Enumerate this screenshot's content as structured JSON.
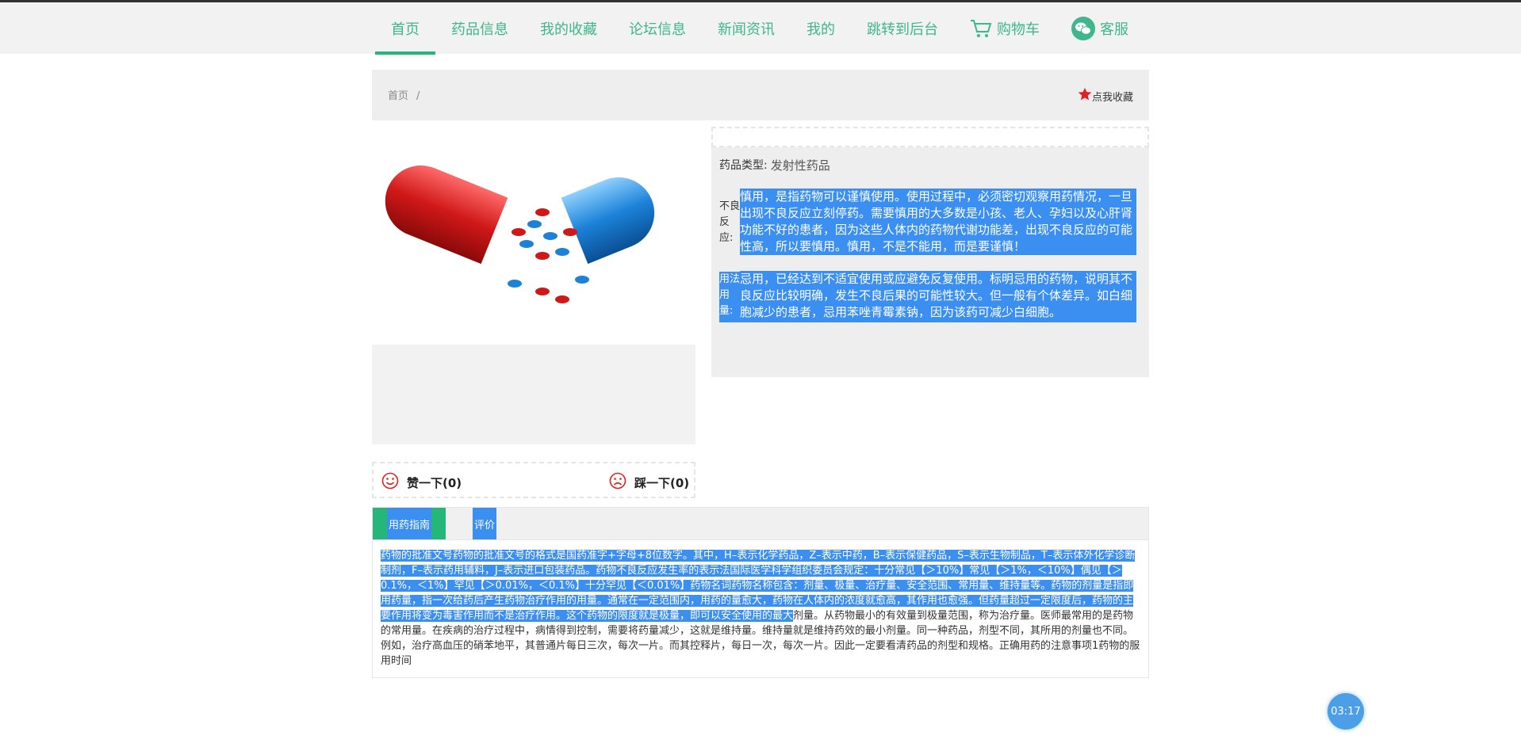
{
  "nav": {
    "items": [
      "首页",
      "药品信息",
      "我的收藏",
      "论坛信息",
      "新闻资讯",
      "我的",
      "跳转到后台"
    ],
    "cart": "购物车",
    "service": "客服"
  },
  "breadcrumb": {
    "home": "首页",
    "sep": "/"
  },
  "favorite": {
    "label": "点我收藏"
  },
  "drug": {
    "type_label": "药品类型:",
    "type_value": "发射性药品",
    "adverse_label": "不良反应:",
    "adverse_text": "慎用，是指药物可以谨慎使用。使用过程中，必须密切观察用药情况，一旦出现不良反应立刻停药。需要慎用的大多数是小孩、老人、孕妇以及心肝肾功能不好的患者，因为这些人体内的药物代谢功能差，出现不良反应的可能性高，所以要慎用。慎用，不是不能用，而是要谨慎！",
    "usage_label": "用法用量:",
    "usage_text": "忌用，已经达到不适宜使用或应避免反复使用。标明忌用的药物，说明其不良反应比较明确，发生不良后果的可能性较大。但一般有个体差异。如白细胞减少的患者，忌用苯唑青霉素钠，因为该药可减少白细胞。"
  },
  "vote": {
    "like": "赞一下(0)",
    "dislike": "踩一下(0)"
  },
  "tabs": {
    "guide": "用药指南",
    "review": "评价"
  },
  "guide_text_selected": "药物的批准文号药物的批准文号的格式是国药准字+字母+8位数字。其中，H–表示化学药品，Z–表示中药，B–表示保健药品，S–表示生物制品，T–表示体外化学诊断制剂，F–表示药用辅料，J–表示进口包装药品。药物不良反应发生率的表示法国际医学科学组织委员会规定：十分常见【＞10%】常见【＞1%，＜10%】偶见【＞0.1%，＜1%】罕见【＞0.01%，＜0.1%】十分罕见【＜0.01%】药物名词药物名称包含：剂量、极量、治疗量、安全范围、常用量、维持量等。药物的剂量是指即用药量，指一次给药后产生药物治疗作用的用量。通常在一定范围内，用药的量愈大，药物在人体内的浓度就愈高，其作用也愈强。但药量超过一定限度后，药物的主要作用将变为毒害作用而不是治疗作用。这个药物的限度就是极量，即可以安全使用的最大",
  "guide_text_rest": "剂量。从药物最小的有效量到极量范围，称为治疗量。医师最常用的是药物的常用量。在疾病的治疗过程中，病情得到控制，需要将药量减少，这就是维持量。维持量就是维持药效的最小剂量。同一种药品，剂型不同，其所用的剂量也不同。例如，治疗高血压的硝苯地平，其普通片每日三次，每次一片。而其控释片，每日一次，每次一片。因此一定要看清药品的剂型和规格。正确用药的注意事项1药物的服用时间",
  "timer": "03:17",
  "colors": {
    "accent": "#3fb68b",
    "selection": "#3b8ff1",
    "star": "#e02020"
  }
}
